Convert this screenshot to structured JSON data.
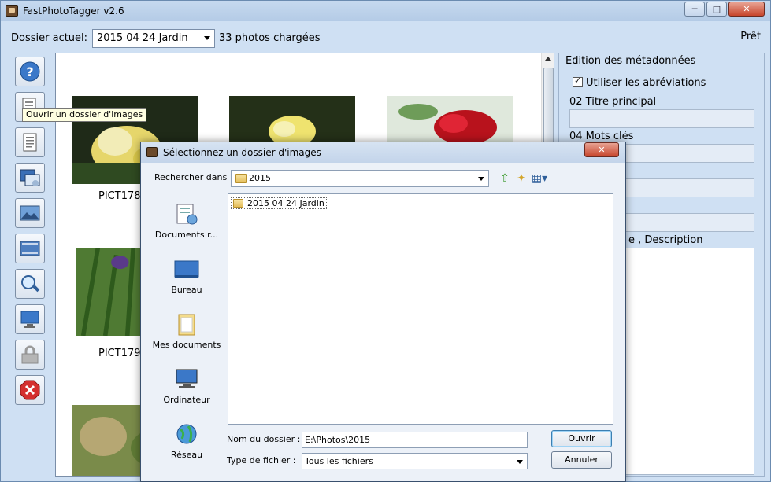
{
  "window": {
    "title": "FastPhotoTagger v2.6",
    "minimize": "─",
    "maximize": "□",
    "close": "✕"
  },
  "toolbar": {
    "current_folder_label": "Dossier actuel:",
    "current_folder_value": "2015 04 24 Jardin",
    "photos_loaded": "33 photos chargées",
    "status": "Prêt"
  },
  "tools": [
    {
      "name": "help-icon"
    },
    {
      "name": "open-folder-icon"
    },
    {
      "name": "document-icon"
    },
    {
      "name": "slideshow-icon"
    },
    {
      "name": "image-icon"
    },
    {
      "name": "filmstrip-icon"
    },
    {
      "name": "magnifier-icon"
    },
    {
      "name": "monitor-icon"
    },
    {
      "name": "lock-icon"
    },
    {
      "name": "exit-icon"
    }
  ],
  "tooltip": "Ouvrir un dossier d'images",
  "thumbnails": [
    {
      "caption": "PICT178",
      "palette": "yellow-flowers"
    },
    {
      "caption": "",
      "palette": "yellow-flowers-2"
    },
    {
      "caption": "",
      "palette": "red-rose"
    },
    {
      "caption": "PICT179",
      "palette": "iris-green"
    },
    {
      "caption": "",
      "palette": "blur-green"
    }
  ],
  "metadata": {
    "title": "Edition des métadonnées",
    "use_abbreviations": "Utiliser les abréviations",
    "title_field": "02 Titre principal",
    "keywords_field": "04 Mots clés",
    "description_label": "e , Description"
  },
  "dialog": {
    "title": "Sélectionnez un dossier d'images",
    "close": "✕",
    "look_in_label": "Rechercher dans :",
    "look_in_value": "2015",
    "places": [
      "Documents r...",
      "Bureau",
      "Mes documents",
      "Ordinateur",
      "Réseau"
    ],
    "file_items": [
      "2015 04 24 Jardin"
    ],
    "folder_name_label": "Nom du dossier :",
    "folder_name_value": "E:\\Photos\\2015",
    "file_type_label": "Type de fichier :",
    "file_type_value": "Tous les fichiers",
    "ok_button": "Ouvrir",
    "cancel_button": "Annuler"
  },
  "colors": {
    "accent": "#3c7fb1",
    "window_bg": "#cfe0f3",
    "exit_red": "#d42f2f"
  }
}
